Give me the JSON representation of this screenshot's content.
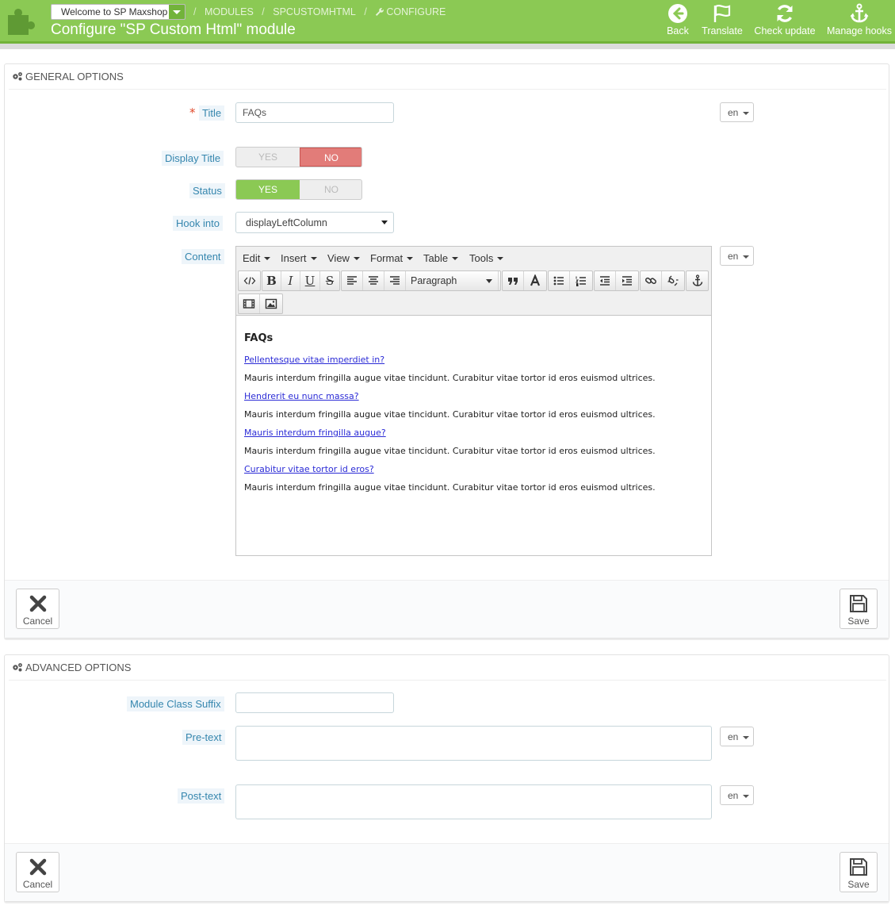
{
  "header": {
    "shop_select": "Welcome to SP Maxshop",
    "breadcrumb": [
      "MODULES",
      "SPCUSTOMHTML",
      "CONFIGURE"
    ],
    "breadcrumb_sep": "/",
    "title": "Configure \"SP Custom Html\" module",
    "toolbar": {
      "back": "Back",
      "translate": "Translate",
      "check_update": "Check update",
      "manage_hooks": "Manage hooks"
    }
  },
  "general": {
    "heading": "General options",
    "title_label": "Title",
    "title_required_mark": "*",
    "title_value": "FAQs",
    "lang": "en",
    "display_title_label": "Display Title",
    "status_label": "Status",
    "yes": "YES",
    "no": "NO",
    "hook_label": "Hook into",
    "hook_value": "displayLeftColumn",
    "content_label": "Content",
    "editor": {
      "menus": [
        "Edit",
        "Insert",
        "View",
        "Format",
        "Table",
        "Tools"
      ],
      "paragraph": "Paragraph",
      "heading": "FAQs",
      "items": [
        {
          "q": "Pellentesque vitae imperdiet in?",
          "a": "Mauris interdum fringilla augue vitae tincidunt. Curabitur vitae tortor id eros euismod ultrices."
        },
        {
          "q": "Hendrerit eu nunc massa?",
          "a": "Mauris interdum fringilla augue vitae tincidunt. Curabitur vitae tortor id eros euismod ultrices."
        },
        {
          "q": "Mauris interdum fringilla augue?",
          "a": "Mauris interdum fringilla augue vitae tincidunt. Curabitur vitae tortor id eros euismod ultrices."
        },
        {
          "q": "Curabitur vitae tortor id eros?",
          "a": "Mauris interdum fringilla augue vitae tincidunt. Curabitur vitae tortor id eros euismod ultrices."
        }
      ]
    },
    "cancel": "Cancel",
    "save": "Save"
  },
  "advanced": {
    "heading": "Advanced options",
    "class_suffix_label": "Module Class Suffix",
    "class_suffix_value": "",
    "pretext_label": "Pre-text",
    "posttext_label": "Post-text",
    "lang": "en",
    "cancel": "Cancel",
    "save": "Save"
  },
  "colors": {
    "header_green": "#8bc954",
    "no_red": "#e27c79",
    "label_blue": "#3586ae",
    "link_blue": "#2b2bd6"
  }
}
